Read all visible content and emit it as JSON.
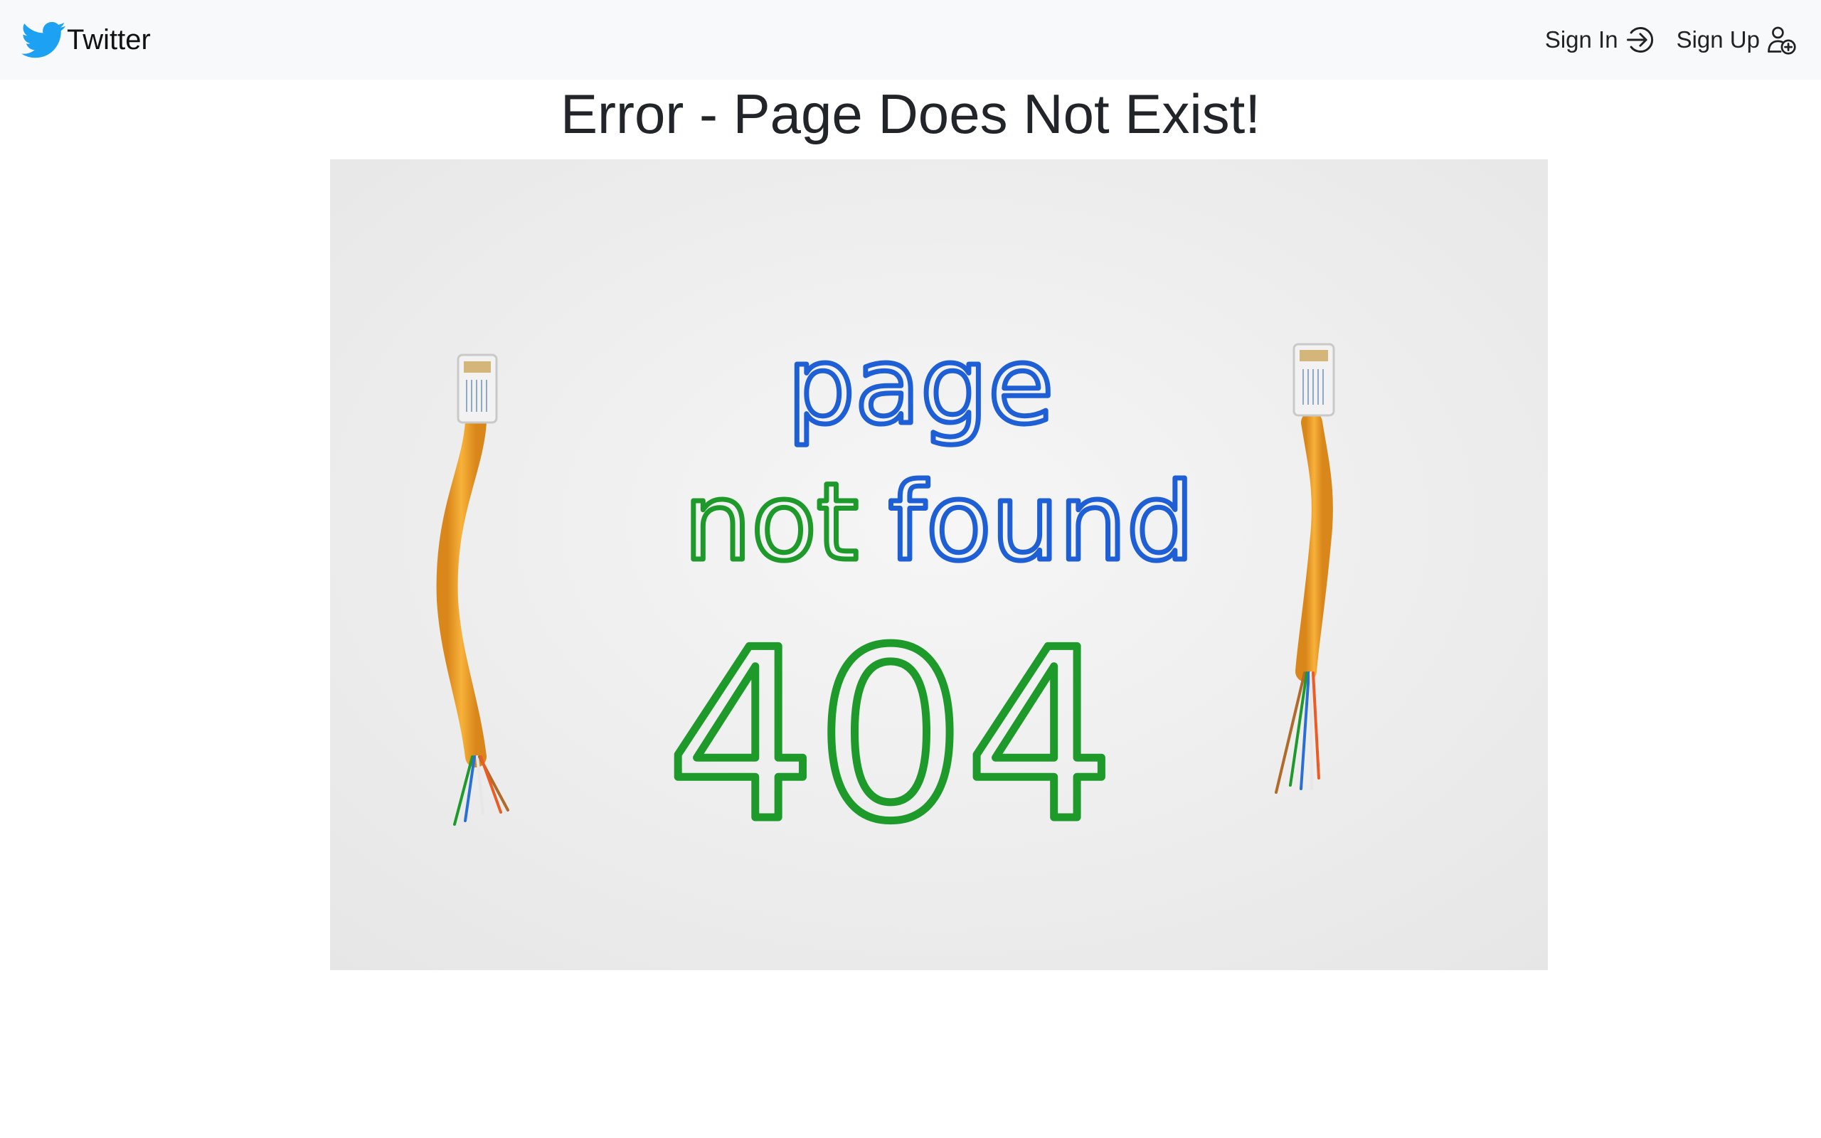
{
  "navbar": {
    "brand_label": "Twitter",
    "brand_icon": "twitter-bird-icon",
    "sign_in_label": "Sign In",
    "sign_in_icon": "sign-in-arrow-icon",
    "sign_up_label": "Sign Up",
    "sign_up_icon": "person-plus-icon"
  },
  "main": {
    "title": "Error - Page Does Not Exist!",
    "image": {
      "line1": "page",
      "line2a": "not",
      "line2b": "found",
      "line3": "404",
      "colors": {
        "cable": "#f2a12a",
        "blue": "#1f5fd6",
        "green": "#1e9a2a",
        "orange": "#ee5a24",
        "background": "#eeeeee"
      }
    }
  },
  "colors": {
    "navbar_bg": "#f8f9fa",
    "brand_blue": "#1da1f2",
    "text": "#212529"
  }
}
